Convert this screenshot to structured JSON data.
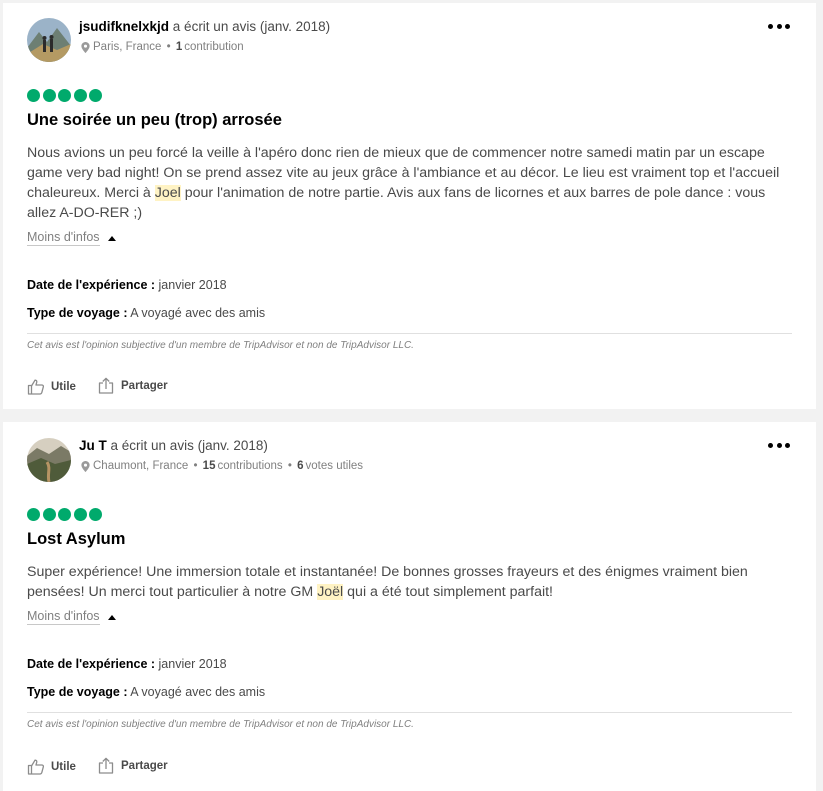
{
  "reviews": [
    {
      "author": "jsudifknelxkjd",
      "wrote_review": "a écrit un avis (janv. 2018)",
      "location": "Paris, France",
      "contributions_count": "1",
      "contributions_label": "contribution",
      "helpful_votes_count": "",
      "helpful_votes_label": "",
      "rating": 5,
      "title": "Une soirée un peu (trop) arrosée",
      "body_before": "Nous avions un peu forcé la veille à l'apéro donc rien de mieux que de commencer notre samedi matin par un escape game very bad night! On se prend assez vite au jeux grâce à l'ambiance et au décor. Le lieu est vraiment top et l'accueil chaleureux. Merci à ",
      "body_highlight": "Joel",
      "body_after": " pour l'animation de notre partie. Avis aux fans de licornes et aux barres de pole dance : vous allez A-DO-RER ;)",
      "more_info": "Moins d'infos",
      "experience_date_label": "Date de l'expérience :",
      "experience_date": "janvier 2018",
      "trip_type_label": "Type de voyage :",
      "trip_type": "A voyagé avec des amis",
      "disclaimer": "Cet avis est l'opinion subjective d'un membre de TripAdvisor et non de TripAdvisor LLC.",
      "helpful_label": "Utile",
      "share_label": "Partager"
    },
    {
      "author": "Ju T",
      "wrote_review": "a écrit un avis (janv. 2018)",
      "location": "Chaumont, France",
      "contributions_count": "15",
      "contributions_label": "contributions",
      "helpful_votes_count": "6",
      "helpful_votes_label": "votes utiles",
      "rating": 5,
      "title": "Lost Asylum",
      "body_before": "Super expérience! Une immersion totale et instantanée! De bonnes grosses frayeurs et des énigmes vraiment bien pensées! Un merci tout particulier à notre GM ",
      "body_highlight": "Joël",
      "body_after": " qui a été tout simplement parfait!",
      "more_info": "Moins d'infos",
      "experience_date_label": "Date de l'expérience :",
      "experience_date": "janvier 2018",
      "trip_type_label": "Type de voyage :",
      "trip_type": "A voyagé avec des amis",
      "disclaimer": "Cet avis est l'opinion subjective d'un membre de TripAdvisor et non de TripAdvisor LLC.",
      "helpful_label": "Utile",
      "share_label": "Partager"
    }
  ],
  "colors": {
    "rating_bubble": "#00aa6c",
    "highlight": "#fff3c4",
    "page_background": "#f2f2f2"
  },
  "icons": {
    "location": "map-pin-icon",
    "more": "more-dots-icon",
    "helpful": "thumbs-up-icon",
    "share": "share-icon",
    "collapse": "caret-up-icon"
  }
}
